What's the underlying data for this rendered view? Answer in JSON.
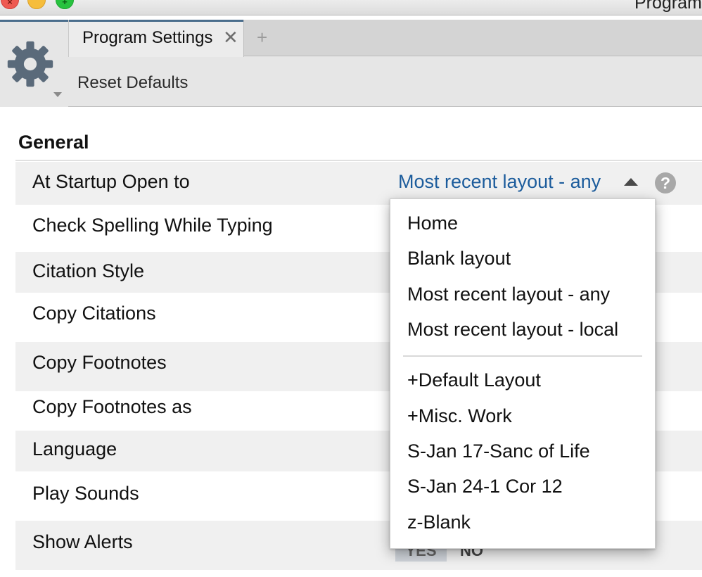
{
  "window": {
    "title": "Program"
  },
  "tabs": {
    "active_label": "Program Settings",
    "close_glyph": "✕",
    "add_glyph": "+"
  },
  "toolbar": {
    "gear_icon": "gear-icon",
    "reset_label": "Reset Defaults"
  },
  "section": {
    "title": "General"
  },
  "settings": {
    "rows": [
      {
        "label": "At Startup Open to"
      },
      {
        "label": "Check Spelling While Typing"
      },
      {
        "label": "Citation Style"
      },
      {
        "label": "Copy Citations"
      },
      {
        "label": "Copy Footnotes"
      },
      {
        "label": "Copy Footnotes as"
      },
      {
        "label": "Language"
      },
      {
        "label": "Play Sounds"
      },
      {
        "label": "Show Alerts"
      }
    ],
    "startup_value": "Most recent layout - any",
    "help_glyph": "?",
    "show_alerts_yes": "YES",
    "show_alerts_no": "NO"
  },
  "dropdown": {
    "items": [
      "Home",
      "Blank layout",
      "Most recent layout - any",
      "Most recent layout - local",
      "+Default Layout",
      "+Misc. Work",
      "S-Jan 17-Sanc of Life",
      "S-Jan 24-1 Cor 12",
      "z-Blank"
    ]
  },
  "colors": {
    "accent_link": "#1c5c9c",
    "tab_accent": "#4a6d8c",
    "row_shade": "#f0f0f0"
  }
}
